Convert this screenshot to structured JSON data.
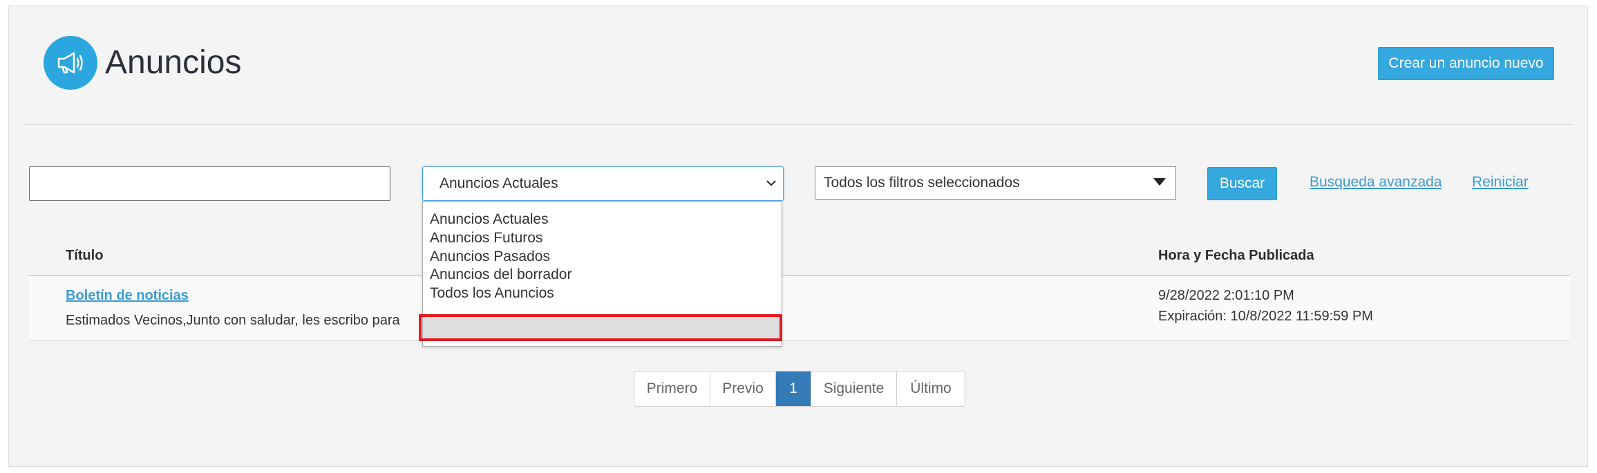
{
  "header": {
    "title": "Anuncios",
    "create_button": "Crear un anuncio nuevo",
    "icon": "megaphone-icon",
    "icon_color": "#2ba6de"
  },
  "filters": {
    "search_value": "",
    "status_select": {
      "selected": "Anuncios Actuales",
      "options": [
        "Anuncios Actuales",
        "Anuncios Futuros",
        "Anuncios Pasados",
        "Anuncios del borrador",
        "Todos los Anuncios"
      ],
      "highlighted": "Todos los Anuncios"
    },
    "category_select": "Todos los filtros seleccionados",
    "search_button": "Buscar",
    "advanced_link": "Busqueda avanzada",
    "reset_link": "Reiniciar"
  },
  "table": {
    "columns": [
      "Título",
      "Hora y Fecha Publicada"
    ],
    "rows": [
      {
        "title": "Boletín de noticias",
        "excerpt": "Estimados Vecinos,Junto con saludar, les escribo para",
        "published": "9/28/2022 2:01:10 PM",
        "expiration": "Expiración: 10/8/2022 11:59:59 PM"
      }
    ]
  },
  "pagination": {
    "first": "Primero",
    "prev": "Previo",
    "current": "1",
    "next": "Siguiente",
    "last": "Último"
  },
  "colors": {
    "accent": "#35a8e0",
    "link": "#3a9bd5",
    "pager_active": "#337ab7",
    "highlight_border": "#e01a22"
  }
}
